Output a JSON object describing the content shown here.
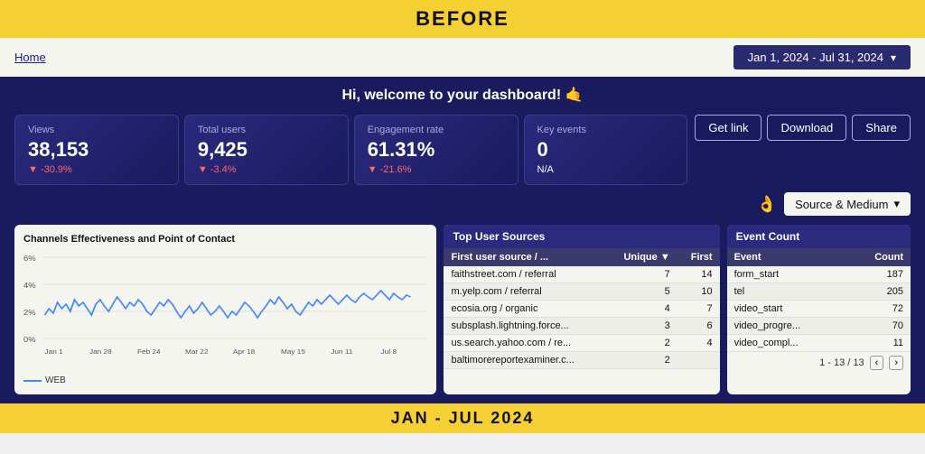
{
  "before_banner": "BEFORE",
  "after_banner": "JAN - JUL 2024",
  "top_bar": {
    "home_link": "Home",
    "date_range": "Jan 1, 2024 - Jul 31, 2024"
  },
  "welcome": {
    "text": "Hi, welcome to your dashboard! 🤙"
  },
  "metrics": [
    {
      "label": "Views",
      "value": "38,153",
      "change": "▼ -30.9%",
      "negative": true
    },
    {
      "label": "Total users",
      "value": "9,425",
      "change": "▼ -3.4%",
      "negative": true
    },
    {
      "label": "Engagement rate",
      "value": "61.31%",
      "change": "▼ -21.6%",
      "negative": true
    },
    {
      "label": "Key events",
      "value": "0",
      "change": "N/A",
      "negative": false
    }
  ],
  "buttons": {
    "get_link": "Get link",
    "download": "Download",
    "share": "Share"
  },
  "filter": {
    "emoji": "👌",
    "source_medium": "Source & Medium"
  },
  "chart": {
    "title": "Channels Effectiveness and Point of Contact",
    "legend": "WEB",
    "x_labels": [
      "Jan 1",
      "Jan 28",
      "Feb 24",
      "Mar 22",
      "Apr 18",
      "May 15",
      "Jun 11",
      "Jul 8"
    ],
    "y_labels": [
      "6%",
      "4%",
      "2%",
      "0%"
    ]
  },
  "top_sources": {
    "title": "Top User Sources",
    "columns": [
      "First user source / ...",
      "Unique ▼",
      "First"
    ],
    "rows": [
      {
        "source": "faithstreet.com / referral",
        "unique": "7",
        "first": "14"
      },
      {
        "source": "m.yelp.com / referral",
        "unique": "5",
        "first": "10"
      },
      {
        "source": "ecosia.org / organic",
        "unique": "4",
        "first": "7"
      },
      {
        "source": "subsplash.lightning.force...",
        "unique": "3",
        "first": "6"
      },
      {
        "source": "us.search.yahoo.com / re...",
        "unique": "2",
        "first": "4"
      },
      {
        "source": "baltimorereportexaminer.c...",
        "unique": "2",
        "first": ""
      }
    ]
  },
  "event_count": {
    "title": "Event Count",
    "columns": [
      "Event",
      "Count"
    ],
    "rows": [
      {
        "event": "form_start",
        "count": "187"
      },
      {
        "event": "tel",
        "count": "205"
      },
      {
        "event": "video_start",
        "count": "72"
      },
      {
        "event": "video_progre...",
        "count": "70"
      },
      {
        "event": "video_compl...",
        "count": "11"
      }
    ],
    "pagination": "1 - 13 / 13"
  }
}
